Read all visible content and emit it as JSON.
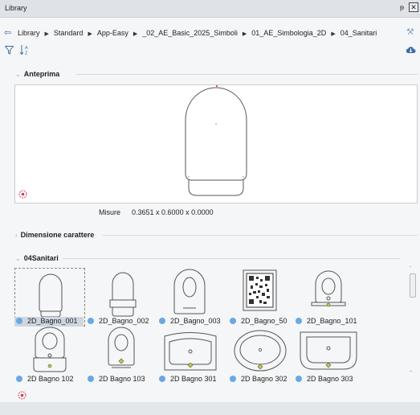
{
  "window": {
    "title": "Library",
    "pin_glyph": "ᵽ",
    "close_glyph": "✕"
  },
  "breadcrumb": {
    "items": [
      "Library",
      "Standard",
      "App-Easy",
      "_02_AE_Basic_2025_Simboli",
      "01_AE_Simbologia_2D",
      "04_Sanitari"
    ],
    "separator": "▶"
  },
  "icons": {
    "back": "back-arrow-icon",
    "wrench": "wrench-icon",
    "filter": "filter-icon",
    "sort": "sort-az-icon",
    "cloud": "cloud-icon",
    "target": "target-icon",
    "item_dot": "item-status-dot-icon"
  },
  "sort_glyph": "A\nZ",
  "sections": {
    "preview": {
      "label": "Anteprima",
      "chevron": "⌄"
    },
    "font_size": {
      "label": "Dimensione carattere",
      "chevron": "›"
    },
    "sanitari": {
      "label": "04Sanitari",
      "chevron": "⌄"
    }
  },
  "measure": {
    "label": "Misure",
    "value": "0.3651 x 0.6000 x 0.0000"
  },
  "items": [
    {
      "label": "2D_Bagno_001",
      "selected": true
    },
    {
      "label": "2D_Bagno_002",
      "selected": false
    },
    {
      "label": "2D_Bagno_003",
      "selected": false
    },
    {
      "label": "2D_Bagno_50",
      "selected": false
    },
    {
      "label": "2D_Bagno_101",
      "selected": false
    },
    {
      "label": "2D Bagno 102",
      "selected": false
    },
    {
      "label": "2D Bagno 103",
      "selected": false
    },
    {
      "label": "2D Bagno 301",
      "selected": false
    },
    {
      "label": "2D Bagno 302",
      "selected": false
    },
    {
      "label": "2D Bagno 303",
      "selected": false
    }
  ],
  "colors": {
    "accent": "#3a6ea5",
    "dot": "#6aa8e4",
    "target": "#d9374f",
    "selection": "#cfd6e0"
  }
}
